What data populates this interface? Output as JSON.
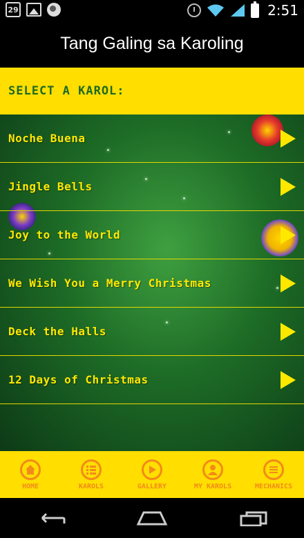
{
  "status_bar": {
    "calendar_day": "29",
    "time": "2:51"
  },
  "header": {
    "title": "Tang Galing sa Karoling"
  },
  "section": {
    "label": "SELECT A KAROL:"
  },
  "karols": [
    {
      "label": "Noche Buena"
    },
    {
      "label": "Jingle Bells"
    },
    {
      "label": "Joy to the World"
    },
    {
      "label": "We Wish You a Merry Christmas"
    },
    {
      "label": "Deck the Halls"
    },
    {
      "label": "12 Days of Christmas"
    }
  ],
  "bottom_nav": [
    {
      "label": "HOME",
      "icon": "home-icon"
    },
    {
      "label": "KAROLS",
      "icon": "list-icon"
    },
    {
      "label": "GALLERY",
      "icon": "play-icon"
    },
    {
      "label": "MY KAROLS",
      "icon": "person-icon"
    },
    {
      "label": "MECHANICS",
      "icon": "menu-icon"
    }
  ],
  "colors": {
    "accent_yellow": "#ffde00",
    "text_green": "#1e6a22",
    "nav_orange": "#f28a1a",
    "list_text_yellow": "#ffe800"
  }
}
